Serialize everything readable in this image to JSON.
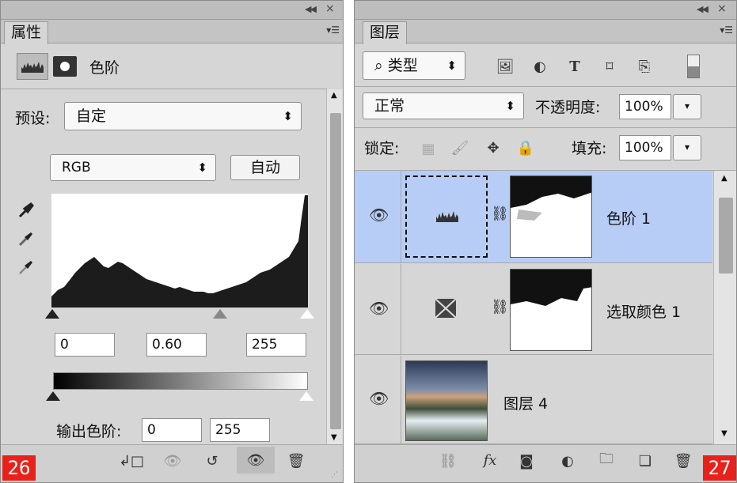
{
  "properties": {
    "tab_label": "属性",
    "title": "色阶",
    "preset_label": "预设:",
    "preset_value": "自定",
    "channel_value": "RGB",
    "auto_label": "自动",
    "input_black": "0",
    "input_gamma": "0.60",
    "input_white": "255",
    "output_label": "输出色阶:",
    "output_black": "0",
    "output_white": "255",
    "badge": "26"
  },
  "layers": {
    "tab_label": "图层",
    "filter_icon": "search-icon",
    "filter_value": "类型",
    "blend_value": "正常",
    "opacity_label": "不透明度:",
    "opacity_value": "100%",
    "lock_label": "锁定:",
    "fill_label": "填充:",
    "fill_value": "100%",
    "items": [
      {
        "name": "色阶 1",
        "selected": true
      },
      {
        "name": "选取颜色 1",
        "selected": false
      },
      {
        "name": "图层 4",
        "selected": false
      }
    ],
    "badge": "27"
  },
  "colors": {
    "selection": "#b8cdf6",
    "badge": "#e8211b",
    "panel": "#d6d6d6"
  }
}
